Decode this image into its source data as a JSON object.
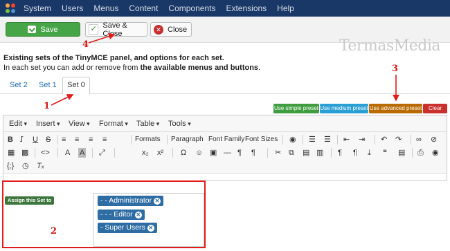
{
  "topnav": {
    "items": [
      "System",
      "Users",
      "Menus",
      "Content",
      "Components",
      "Extensions",
      "Help"
    ]
  },
  "toolbar": {
    "save_label": "Save",
    "save_close_label": "Save & Close",
    "close_label": "Close",
    "watermark": "TermasMedia"
  },
  "description": {
    "line1": "Existing sets of the TinyMCE panel, and options for each set.",
    "line2_prefix": "In each set you can add or remove from ",
    "line2_bold": "the available menus and buttons",
    "line2_suffix": "."
  },
  "tabs": [
    "Set 2",
    "Set 1",
    "Set 0"
  ],
  "active_tab": "Set 0",
  "presets": {
    "simple": "Use simple preset",
    "medium": "Use medium preset",
    "advanced": "Use advanced preset",
    "clear": "Clear"
  },
  "editor": {
    "menus": [
      "Edit",
      "Insert",
      "View",
      "Format",
      "Table",
      "Tools"
    ],
    "toolbar_text": [
      "Formats",
      "Paragraph",
      "Font Family",
      "Font Sizes"
    ]
  },
  "assign": {
    "label": "Assign this Set to",
    "groups": [
      "- - Administrator",
      "- - - Editor",
      "- Super Users"
    ]
  },
  "annotations": [
    "1",
    "2",
    "3",
    "4"
  ],
  "colors": {
    "nav": "#1a3867",
    "save": "#46a546",
    "simple": "#3f9d3f",
    "medium": "#2a9fd6",
    "advanced": "#b96a00",
    "clear": "#c9302c",
    "annotation": "#e21b1b"
  }
}
